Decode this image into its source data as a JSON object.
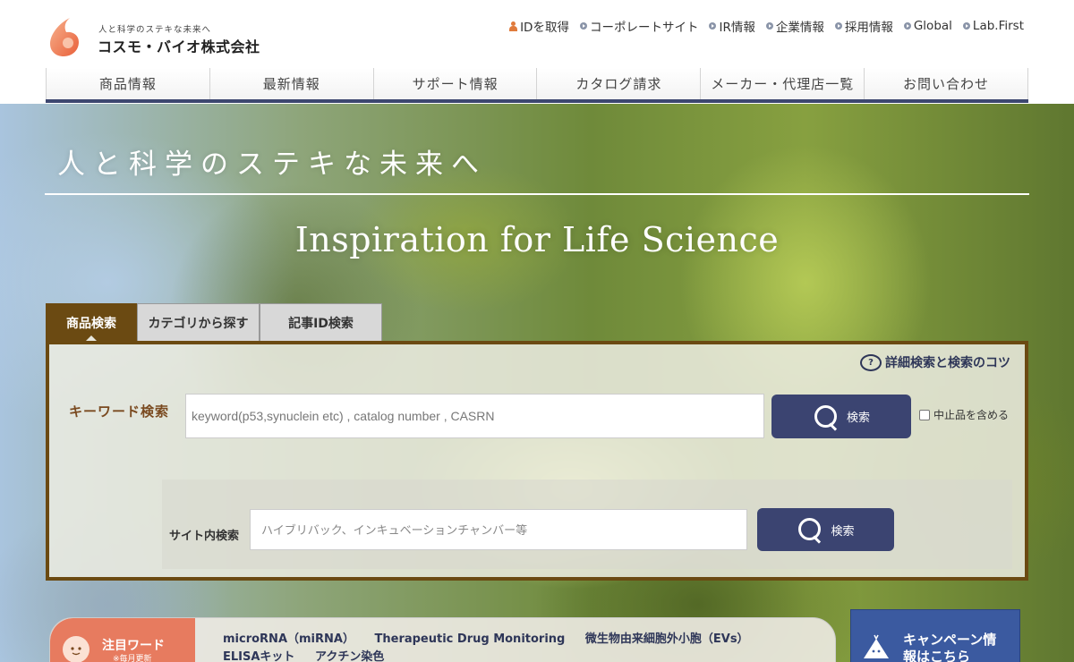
{
  "header": {
    "logo_tagline": "人と科学のステキな未来へ",
    "logo_name": "コスモ・バイオ株式会社",
    "brand_color": "#e9774b",
    "nav_accent_color": "#3d4770"
  },
  "util_nav": [
    {
      "label": "IDを取得",
      "icon": "person-icon"
    },
    {
      "label": "コーポレートサイト",
      "icon": "arrow-bullet-icon"
    },
    {
      "label": "IR情報",
      "icon": "arrow-bullet-icon"
    },
    {
      "label": "企業情報",
      "icon": "arrow-bullet-icon"
    },
    {
      "label": "採用情報",
      "icon": "arrow-bullet-icon"
    },
    {
      "label": "Global",
      "icon": "arrow-bullet-icon"
    },
    {
      "label": "Lab.First",
      "icon": "arrow-bullet-icon"
    }
  ],
  "main_nav": [
    {
      "label": "商品情報"
    },
    {
      "label": "最新情報"
    },
    {
      "label": "サポート情報"
    },
    {
      "label": "カタログ請求"
    },
    {
      "label": "メーカー・代理店一覧"
    },
    {
      "label": "お問い合わせ"
    }
  ],
  "hero": {
    "tagline": "人と科学のステキな未来へ",
    "title": "Inspiration for Life Science"
  },
  "search": {
    "tabs": [
      {
        "label": "商品検索",
        "active": true
      },
      {
        "label": "カテゴリから探す",
        "active": false
      },
      {
        "label": "記事ID検索",
        "active": false
      }
    ],
    "tips_label": "詳細検索と検索のコツ",
    "tips_icon_text": "?",
    "keyword_label": "キーワード検索",
    "keyword_placeholder": "keyword(p53,synuclein etc) , catalog number , CASRN",
    "keyword_button": "検索",
    "discontinued_label": "中止品を含める",
    "discontinued_checked": false,
    "site_label": "サイト内検索",
    "site_placeholder": "ハイブリバック、インキュベーションチャンバー等",
    "site_button": "検索",
    "panel_border_color": "#6b4a12",
    "button_color": "#3b4471"
  },
  "hot_words": {
    "title": "注目ワード",
    "subtitle": "※毎月更新",
    "items": [
      "microRNA（miRNA）",
      "Therapeutic Drug Monitoring",
      "微生物由来細胞外小胞（EVs）",
      "ELISAキット",
      "アクチン染色"
    ],
    "badge_color": "#e77b5f"
  },
  "campaign": {
    "label": "キャンペーン情報はこちら",
    "line1": "キャンペーン情",
    "line2": "報はこちら"
  }
}
